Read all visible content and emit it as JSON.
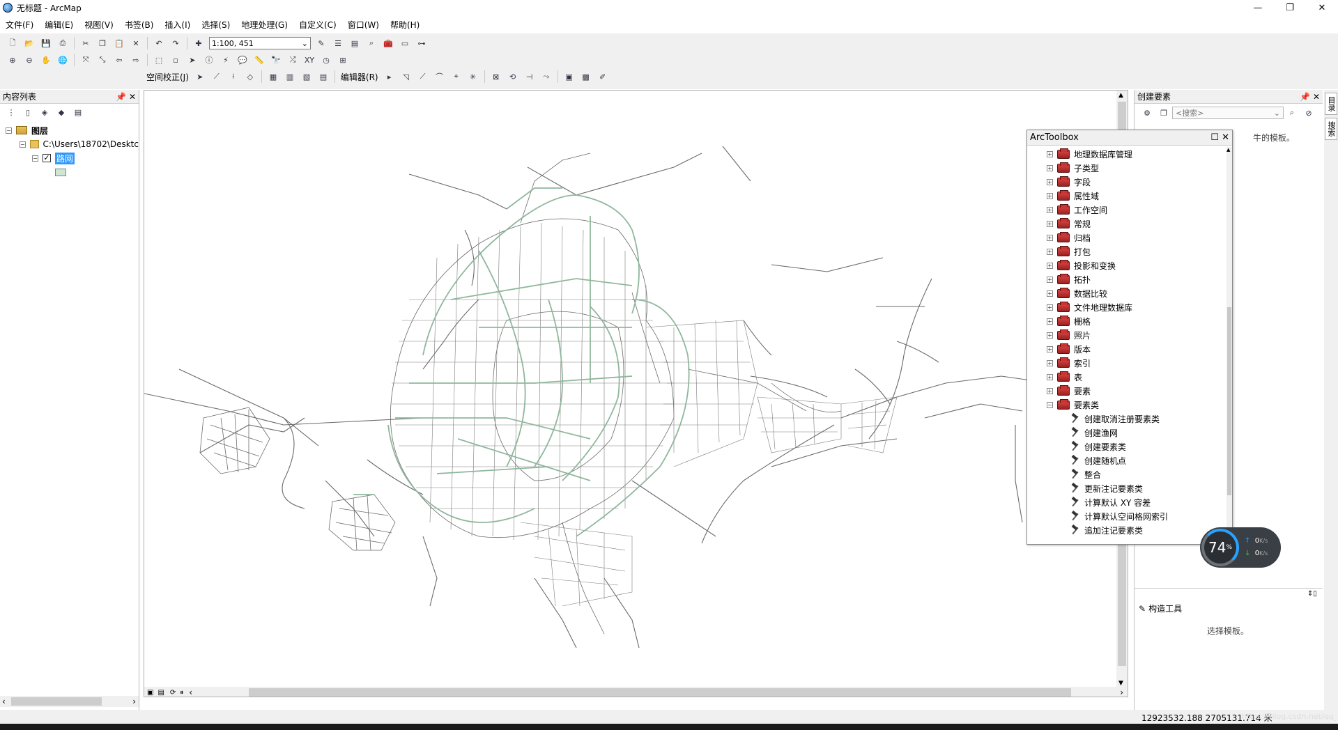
{
  "window": {
    "title": "无标题 - ArcMap",
    "controls": {
      "minimize": "—",
      "restore": "❐",
      "close": "✕"
    }
  },
  "menu": [
    "文件(F)",
    "编辑(E)",
    "视图(V)",
    "书签(B)",
    "插入(I)",
    "选择(S)",
    "地理处理(G)",
    "自定义(C)",
    "窗口(W)",
    "帮助(H)"
  ],
  "toolbar": {
    "scale": "1:100, 451",
    "georef_label": "空间校正(J)",
    "editor_label": "编辑器(R)"
  },
  "toc": {
    "title": "内容列表",
    "root_label": "图层",
    "folder_label": "C:\\Users\\18702\\Desktc",
    "layer_label": "路网",
    "layer_visible": true
  },
  "create_features": {
    "title": "创建要素",
    "search_placeholder": "<搜索>",
    "hint_partial": "牛的模板。",
    "construct_title": "构造工具",
    "construct_hint": "选择模板。"
  },
  "side_tabs": [
    "目录",
    "搜索"
  ],
  "arctoolbox": {
    "title": "ArcToolbox",
    "toolsets": [
      "地理数据库管理",
      "子类型",
      "字段",
      "属性域",
      "工作空间",
      "常规",
      "归档",
      "打包",
      "投影和变换",
      "拓扑",
      "数据比较",
      "文件地理数据库",
      "栅格",
      "照片",
      "版本",
      "索引",
      "表",
      "要素",
      "要素类"
    ],
    "tools": [
      "创建取消注册要素类",
      "创建渔网",
      "创建要素类",
      "创建随机点",
      "整合",
      "更新注记要素类",
      "计算默认 XY 容差",
      "计算默认空间格网索引",
      "追加注记要素类"
    ]
  },
  "net_monitor": {
    "percent": "74",
    "unit": "%",
    "up": "0",
    "down": "0",
    "rate_unit": "K/s"
  },
  "status": {
    "coords": "12923532.188  2705131.714 米",
    "watermark": "https://blog.csdn.net/qq_43886350"
  },
  "colors": {
    "road_light": "#8fb79c",
    "road_dark": "#6a6a6a",
    "selection": "#3399ff"
  }
}
